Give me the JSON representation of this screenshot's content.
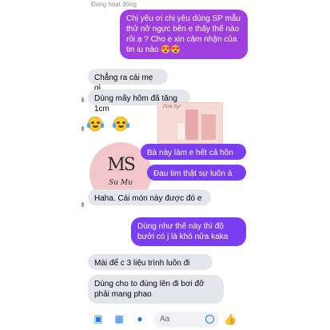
{
  "status_text": "Đang hoạt động",
  "messages": {
    "m1": "Chị yêu ơi chị yêu dùng SP mẫu thử nở ngực bên e thấy thế nào rồi ạ ? Cho e xin cảm nhận của tin iu nào 😍😍",
    "m2": "Chẳng ra cái mẹ gì",
    "m3": "Dùng mấy hôm đã tăng 1cm",
    "m4": "Bà này làm e hết cả hồn",
    "m5": "Đau tim thật sự luôn á",
    "m6": "Haha. Cái món này được đó e",
    "m7": "Dùng như thế này thì độ bưởi có j là khó nửa kaka",
    "m8": "Mài để c 3 liệu trình luôn đi",
    "m9": "Dùng cho to đùng lên đi bơi đỡ phải mang phao"
  },
  "logo": {
    "mark": "MS",
    "name": "Su Mu"
  },
  "product_label": "Pink Syr",
  "composer": {
    "placeholder": "Aa"
  },
  "icons": [
    "camera-icon",
    "image-icon",
    "microphone-icon",
    "emoji-icon",
    "thumbs-up-icon"
  ],
  "colors": {
    "outgoing": "#7b3df0",
    "incoming": "#e4e6eb",
    "accent": "#1877f2"
  }
}
